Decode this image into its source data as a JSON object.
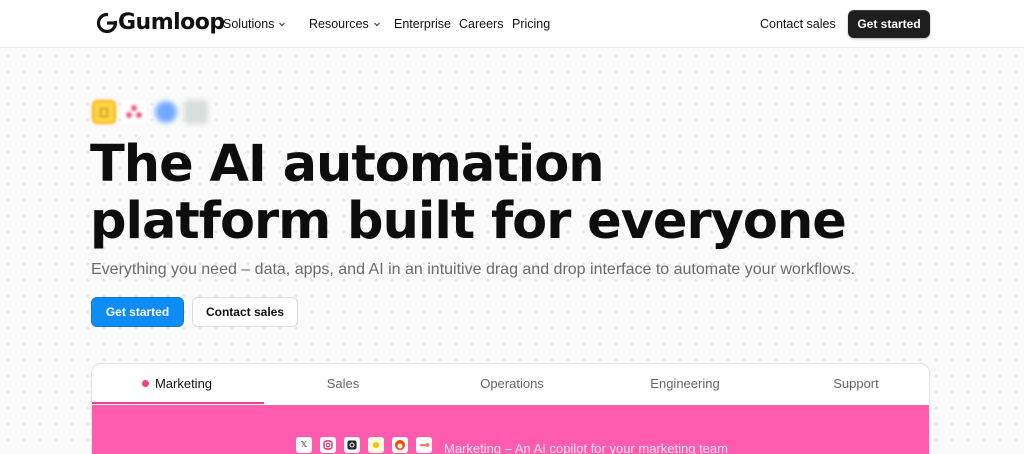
{
  "nav": {
    "logo_text": "Gumloop",
    "links": [
      {
        "label": "Solutions",
        "has_dropdown": true
      },
      {
        "label": "Resources",
        "has_dropdown": true
      },
      {
        "label": "Enterprise"
      },
      {
        "label": "Careers"
      },
      {
        "label": "Pricing"
      }
    ],
    "contact_label": "Contact sales",
    "cta_label": "Get started"
  },
  "hero": {
    "icons": [
      "google-slides-icon",
      "asana-icon",
      "globe-icon",
      "app-icon"
    ],
    "headline_line1": "The AI automation",
    "headline_line2": "platform built for everyone",
    "subtitle": "Everything you need – data, apps, and AI in an intuitive drag and drop interface to automate your workflows.",
    "primary_cta": "Get started",
    "secondary_cta": "Contact sales"
  },
  "tabs": {
    "items": [
      {
        "label": "Marketing",
        "active": true
      },
      {
        "label": "Sales"
      },
      {
        "label": "Operations"
      },
      {
        "label": "Engineering"
      },
      {
        "label": "Support"
      }
    ],
    "active_color": "#ef3e8f"
  },
  "marketing_panel": {
    "background": "#ff5caf",
    "integration_icons": [
      "x-icon",
      "instagram-icon",
      "threads-icon",
      "sun-icon",
      "reddit-icon",
      "hubspot-icon"
    ],
    "caption": "Marketing – An AI copilot for your marketing team"
  },
  "colors": {
    "primary_button": "#0d8cf5",
    "dark_button": "#1e1e1e"
  }
}
